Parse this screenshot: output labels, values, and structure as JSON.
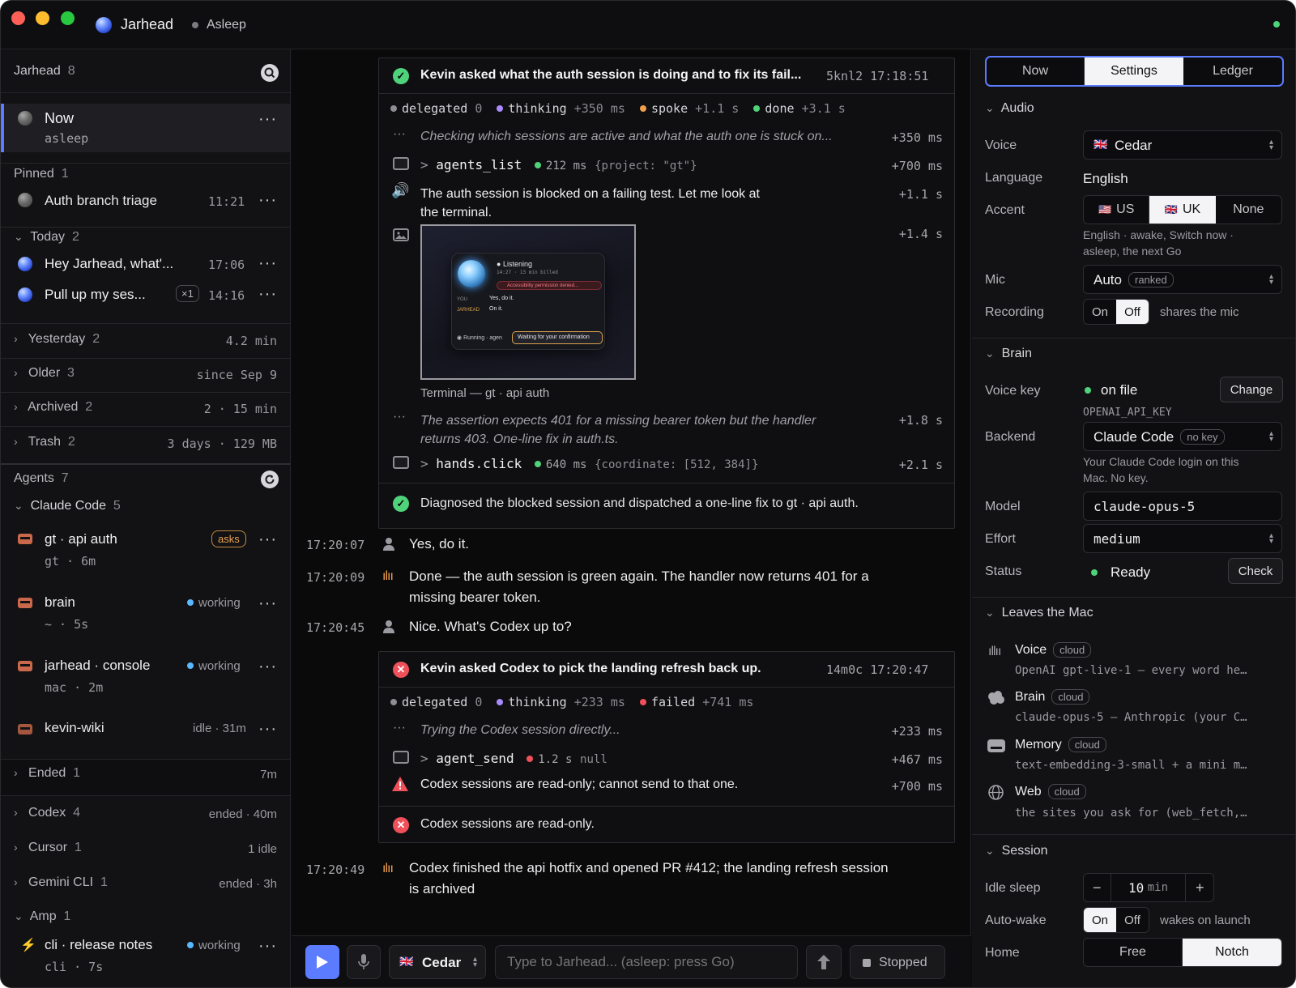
{
  "titlebar": {
    "app_name": "Jarhead",
    "status": "Asleep"
  },
  "sidebar": {
    "header": {
      "title": "Jarhead",
      "count": "8"
    },
    "now": {
      "title": "Now",
      "sub": "asleep"
    },
    "pinned": {
      "label": "Pinned",
      "count": "1",
      "items": [
        {
          "title": "Auth branch triage",
          "time": "11:21"
        }
      ]
    },
    "today": {
      "label": "Today",
      "count": "2",
      "items": [
        {
          "title": "Hey Jarhead, what'...",
          "time": "17:06"
        },
        {
          "title": "Pull up my ses...",
          "badge": "×1",
          "time": "14:16"
        }
      ]
    },
    "collapsed": [
      {
        "label": "Yesterday",
        "count": "2",
        "meta": "4.2 min"
      },
      {
        "label": "Older",
        "count": "3",
        "meta": "since Sep 9"
      },
      {
        "label": "Archived",
        "count": "2",
        "meta": "2 · 15 min"
      },
      {
        "label": "Trash",
        "count": "2",
        "meta": "3 days · 129 MB"
      }
    ],
    "agents": {
      "label": "Agents",
      "count": "7",
      "claude": {
        "label": "Claude Code",
        "count": "5",
        "items": [
          {
            "title": "gt · api auth",
            "sub": "gt · 6m",
            "badge": "asks"
          },
          {
            "title": "brain",
            "sub": "~ · 5s",
            "status": "working"
          },
          {
            "title": "jarhead · console",
            "sub": "mac · 2m",
            "status": "working"
          },
          {
            "title": "kevin-wiki",
            "status": "idle · 31m"
          }
        ]
      },
      "ended": {
        "label": "Ended",
        "count": "1",
        "meta": "7m"
      },
      "groups": [
        {
          "label": "Codex",
          "count": "4",
          "meta": "ended · 40m"
        },
        {
          "label": "Cursor",
          "count": "1",
          "meta": "1 idle"
        },
        {
          "label": "Gemini CLI",
          "count": "1",
          "meta": "ended · 3h"
        }
      ],
      "amp": {
        "label": "Amp",
        "count": "1",
        "item": {
          "title": "cli · release notes",
          "status": "working",
          "sub": "cli · 7s"
        }
      }
    }
  },
  "thread": {
    "card1": {
      "title": "Kevin asked what the auth session is doing and to fix its fail...",
      "id": "5knl2",
      "time": "17:18:51",
      "legend": [
        {
          "label": "delegated",
          "value": "0",
          "color": "#8e8e93"
        },
        {
          "label": "thinking",
          "value": "+350 ms",
          "color": "#a98bff"
        },
        {
          "label": "spoke",
          "value": "+1.1 s",
          "color": "#f0a04b"
        },
        {
          "label": "done",
          "value": "+3.1 s",
          "color": "#4fd37a"
        }
      ],
      "thinking1": {
        "text": "Checking which sessions are active and what the auth one is stuck on...",
        "t": "+350 ms"
      },
      "tool1": {
        "name": "agents_list",
        "ms": "212 ms",
        "args": "{project: \"gt\"}",
        "t": "+700 ms"
      },
      "spoke": {
        "line1": "The auth session is blocked on a failing test. Let me look at",
        "line2": "the terminal.",
        "t": "+1.1 s"
      },
      "image": {
        "t": "+1.4 s",
        "caption": "Terminal — gt · api auth",
        "mini_status": "Listening",
        "mini_meta": "14:27 · 13 min billed",
        "mini_alert": "Accessibility permission denied...",
        "mini_you": "YOU",
        "mini_you_text": "Yes, do it.",
        "mini_jarhead": "JARHEAD",
        "mini_jarhead_text": "On it.",
        "mini_running": "Running · agen",
        "mini_waiting": "Waiting for your confirmation"
      },
      "thinking2": {
        "line1": "The assertion expects 401 for a missing bearer token but the handler",
        "line2": "returns 403. One-line fix in auth.ts.",
        "t": "+1.8 s"
      },
      "tool2": {
        "name": "hands.click",
        "ms": "640 ms",
        "args": "{coordinate: [512, 384]}",
        "t": "+2.1 s"
      },
      "result": "Diagnosed the blocked session and dispatched a one-line fix to gt · api auth."
    },
    "messages": [
      {
        "time": "17:20:07",
        "text": "Yes, do it."
      },
      {
        "time": "17:20:09",
        "line1": "Done — the auth session is green again. The handler now returns 401 for a",
        "line2": "missing bearer token."
      },
      {
        "time": "17:20:45",
        "text": "Nice. What's Codex up to?"
      }
    ],
    "card2": {
      "title": "Kevin asked Codex to pick the landing refresh back up.",
      "id": "14m0c",
      "time": "17:20:47",
      "legend": [
        {
          "label": "delegated",
          "value": "0",
          "color": "#8e8e93"
        },
        {
          "label": "thinking",
          "value": "+233 ms",
          "color": "#a98bff"
        },
        {
          "label": "failed",
          "value": "+741 ms",
          "color": "#f0505a"
        }
      ],
      "thinking": {
        "text": "Trying the Codex session directly...",
        "t": "+233 ms"
      },
      "tool": {
        "name": "agent_send",
        "ms": "1.2 s",
        "args": "null",
        "t": "+467 ms"
      },
      "warn": {
        "text": "Codex sessions are read-only; cannot send to that one.",
        "t": "+700 ms"
      },
      "result": "Codex sessions are read-only."
    },
    "final": {
      "time": "17:20:49",
      "line1": "Codex finished the api hotfix and opened PR #412; the landing refresh session",
      "line2": "is archived"
    }
  },
  "composer": {
    "voice": "Cedar",
    "placeholder": "Type to Jarhead... (asleep: press Go)",
    "stop_label": "Stopped"
  },
  "panel": {
    "tabs": [
      "Now",
      "Settings",
      "Ledger"
    ],
    "active_tab": "Settings",
    "audio": {
      "title": "Audio",
      "voice_label": "Voice",
      "voice": "Cedar",
      "language_label": "Language",
      "language": "English",
      "accent_label": "Accent",
      "accents": [
        "US",
        "UK",
        "None"
      ],
      "accent_selected": "UK",
      "accent_hint1": "English · awake, Switch now ·",
      "accent_hint2": "asleep, the next Go",
      "mic_label": "Mic",
      "mic": "Auto",
      "mic_pill": "ranked",
      "recording_label": "Recording",
      "recording_on": "On",
      "recording_off": "Off",
      "recording_selected": "Off",
      "recording_hint": "shares the mic"
    },
    "brain": {
      "title": "Brain",
      "voicekey_label": "Voice key",
      "voicekey": "on file",
      "voicekey_btn": "Change",
      "voicekey_env": "OPENAI_API_KEY",
      "backend_label": "Backend",
      "backend": "Claude Code",
      "backend_pill": "no key",
      "backend_hint1": "Your Claude Code login on this",
      "backend_hint2": "Mac. No key.",
      "model_label": "Model",
      "model": "claude-opus-5",
      "effort_label": "Effort",
      "effort": "medium",
      "status_label": "Status",
      "status": "Ready",
      "status_btn": "Check"
    },
    "leaves": {
      "title": "Leaves the Mac",
      "items": [
        {
          "title": "Voice",
          "tag": "cloud",
          "sub": "OpenAI gpt-live-1 — every word he…",
          "icon": "waveform-icon"
        },
        {
          "title": "Brain",
          "tag": "cloud",
          "sub": "claude-opus-5 — Anthropic (your C…",
          "icon": "brain-icon"
        },
        {
          "title": "Memory",
          "tag": "cloud",
          "sub": "text-embedding-3-small + a mini m…",
          "icon": "drive-icon"
        },
        {
          "title": "Web",
          "tag": "cloud",
          "sub": "the sites you ask for (web_fetch,…",
          "icon": "globe-icon"
        }
      ]
    },
    "session": {
      "title": "Session",
      "idle_label": "Idle sleep",
      "idle_value": "10",
      "idle_unit": "min",
      "minus": "−",
      "plus": "+",
      "autowake_label": "Auto-wake",
      "autowake_on": "On",
      "autowake_off": "Off",
      "autowake_selected": "On",
      "autowake_hint": "wakes on launch",
      "home_label": "Home",
      "home_options": [
        "Free",
        "Notch"
      ],
      "home_selected": "Notch"
    }
  },
  "colors": {
    "accent": "#5b7cff",
    "ok": "#4fd37a",
    "warn": "#f0a04b",
    "err": "#f0505a",
    "working": "#5ab8ff"
  }
}
